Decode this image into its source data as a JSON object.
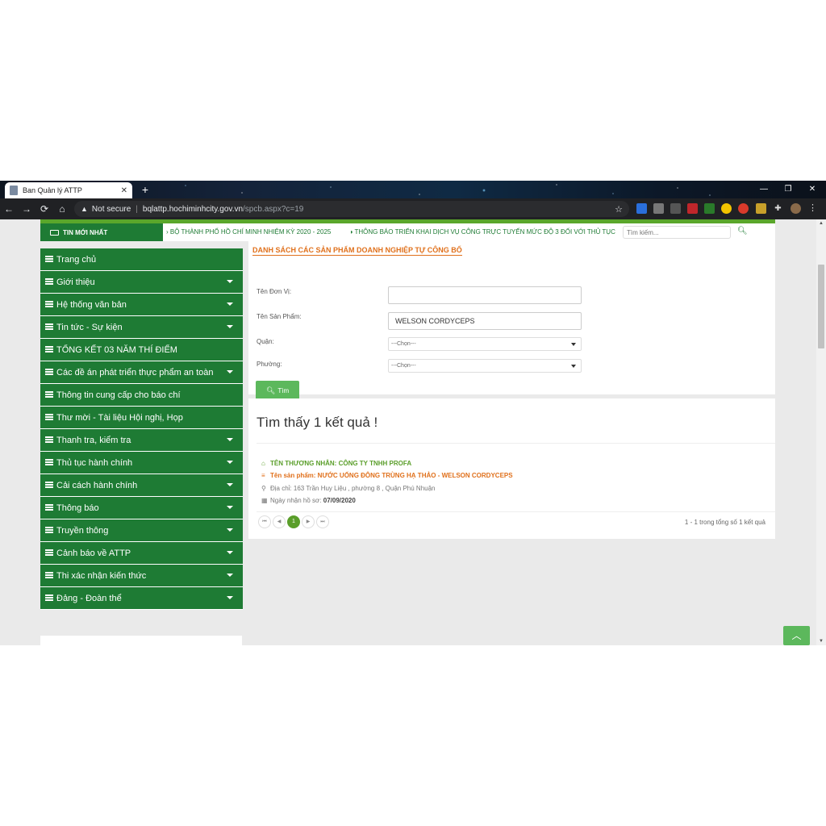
{
  "browser": {
    "tab_title": "Ban Quản lý ATTP",
    "tab_close": "✕",
    "new_tab": "+",
    "min": "—",
    "restore": "❐",
    "close": "✕",
    "not_secure": "Not secure",
    "url_host": "bqlattp.hochiminhcity.gov.vn",
    "url_path": "/spcb.aspx?c=19",
    "back": "←",
    "forward": "→",
    "reload": "⟳",
    "home": "⌂",
    "bookmark": "☆",
    "menu": "⋮"
  },
  "newsbar": {
    "label": "TIN MỚI NHẤT",
    "items": [
      "› BỘ THÀNH PHỐ HỒ CHÍ MINH NHIỆM KỲ 2020 - 2025",
      "◑ THÔNG BÁO TRIỂN KHAI DỊCH VỤ CÔNG TRỰC TUYẾN MỨC ĐỘ 3 ĐỐI VỚI THỦ TỤC"
    ],
    "search_placeholder": "Tìm kiếm..."
  },
  "sidebar": {
    "items": [
      {
        "label": "Trang chủ"
      },
      {
        "label": "Giới thiệu"
      },
      {
        "label": "Hệ thống văn bản"
      },
      {
        "label": "Tin tức - Sự kiện"
      },
      {
        "label": "TỔNG KẾT 03 NĂM THÍ ĐIỂM"
      },
      {
        "label": "Các đề án phát triển thực phẩm an toàn"
      },
      {
        "label": "Thông tin cung cấp cho báo chí"
      },
      {
        "label": "Thư mời - Tài liệu Hội nghị, Họp"
      },
      {
        "label": "Thanh tra, kiểm tra"
      },
      {
        "label": "Thủ tục hành chính"
      },
      {
        "label": "Cải cách hành chính"
      },
      {
        "label": "Thông báo"
      },
      {
        "label": "Truyền thông"
      },
      {
        "label": "Cảnh báo về ATTP"
      },
      {
        "label": "Thi xác nhận kiến thức"
      },
      {
        "label": "Đảng - Đoàn thể"
      }
    ]
  },
  "form": {
    "title": "DANH SÁCH CÁC SẢN PHẨM DOANH NGHIỆP TỰ CÔNG BỐ",
    "unit_label": "Tên Đơn Vị:",
    "unit_value": "",
    "product_label": "Tên Sản Phẩm:",
    "product_value": "WELSON CORDYCEPS",
    "district_label": "Quận:",
    "district_value": "---Chọn---",
    "ward_label": "Phường:",
    "ward_value": "---Chọn---",
    "find_label": "Tìm"
  },
  "results": {
    "title": "Tìm thấy 1 kết quả !",
    "item": {
      "merchant": "TÊN THƯƠNG NHÂN: CÔNG TY TNHH PROFA",
      "product": "Tên sản phẩm: NƯỚC UỐNG ĐÔNG TRÙNG HẠ THẢO - WELSON CORDYCEPS",
      "address": "Địa chỉ: 163 Trần Huy Liệu , phường 8 , Quận Phú Nhuận",
      "date_label": "Ngày nhận hồ sơ:",
      "date_value": "07/09/2020"
    },
    "pager": {
      "first": "⏮",
      "prev": "◀",
      "current": "1",
      "next": "▶",
      "last": "⏭"
    },
    "pager_info": "1 - 1 trong tổng số 1 kết quả"
  },
  "back_to_top": "︿"
}
